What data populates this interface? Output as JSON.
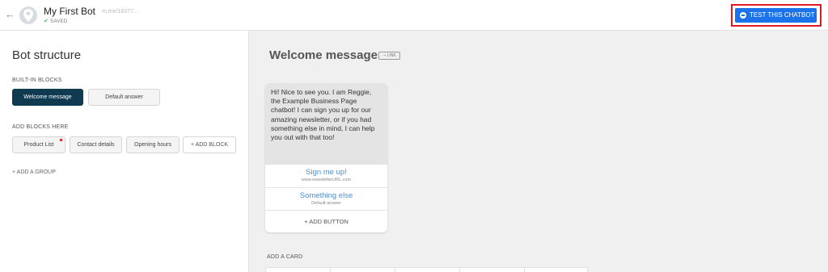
{
  "header": {
    "back_arrow": "←",
    "bot_name": "My First Bot",
    "saved_label": "SAVED",
    "bot_url": "m.me/18377...",
    "avatar_icon": "location-pin-icon",
    "test_button_label": "TEST THIS CHATBOT",
    "test_button_icon": "messenger-icon",
    "accent_color": "#1a73e8",
    "highlight_color": "#e01a22"
  },
  "structure": {
    "title": "Bot structure",
    "builtin_label": "BUILT-IN BLOCKS",
    "builtin_blocks": [
      "Welcome message",
      "Default answer"
    ],
    "add_blocks_label": "ADD BLOCKS HERE",
    "custom_blocks": [
      "Product List",
      "Contact details",
      "Opening hours"
    ],
    "add_block_label": "+ ADD BLOCK",
    "add_group_label": "+ ADD A GROUP"
  },
  "editor": {
    "title": "Welcome message",
    "link_label": "LINK",
    "message_text": "Hi! Nice to see you. I am Reggie, the Example Business Page chatbot! I can sign you up for our amazing newsletter, or if you had something else in mind, I can help you out with that too!",
    "buttons": [
      {
        "title": "Sign me up!",
        "subtitle": "www.newsletterURL.com"
      },
      {
        "title": "Something else",
        "subtitle": "Default answer"
      }
    ],
    "add_button_label": "+ ADD BUTTON",
    "add_card_label": "ADD A CARD"
  }
}
